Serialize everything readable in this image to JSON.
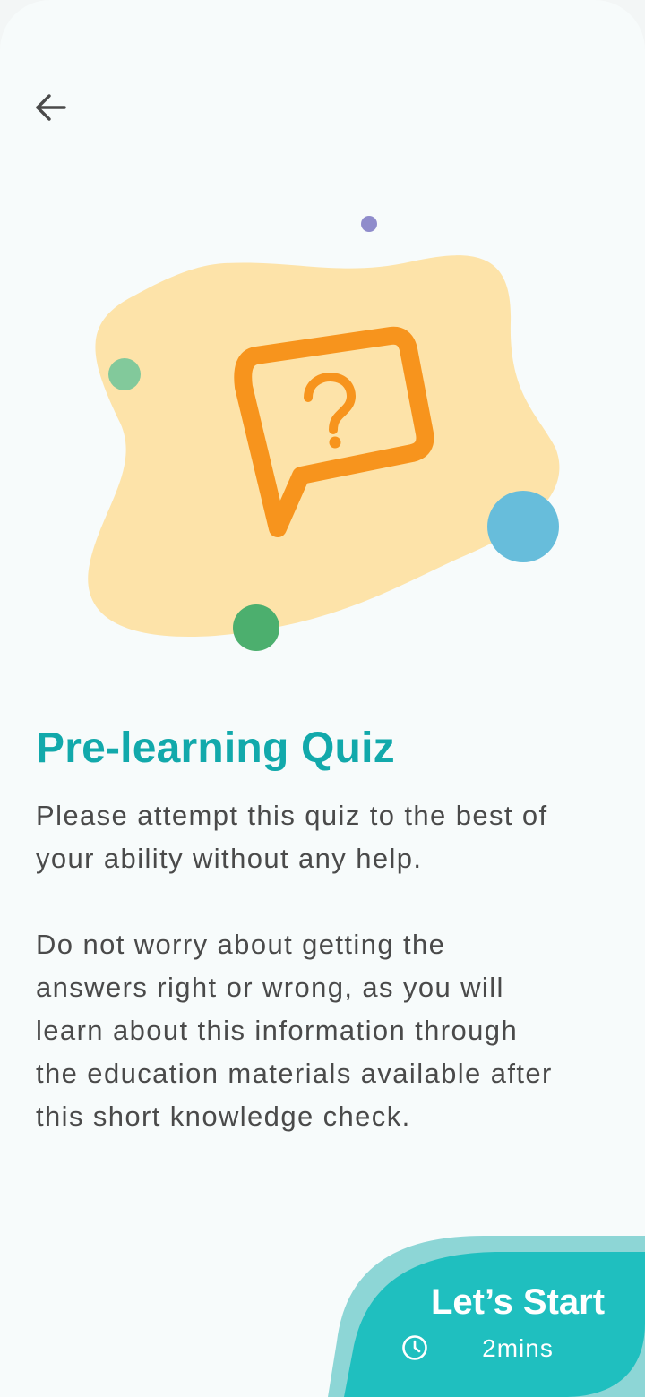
{
  "header": {
    "back_icon": "arrow-left-icon"
  },
  "illustration": {
    "icon": "question-speech-bubble-icon",
    "colors": {
      "blob": "#fde3a9",
      "bubble": "#f7941d",
      "dot_purple": "#8f8ccb",
      "dot_light_green": "#82c99b",
      "dot_blue": "#67bddb",
      "dot_green": "#4caf6e"
    }
  },
  "content": {
    "title": "Pre-learning Quiz",
    "paragraph_1_lines": [
      "Please attempt this quiz to the best of",
      "your ability without any help."
    ],
    "paragraph_2_lines": [
      "Do not worry about getting the",
      "answers right or wrong, as you will",
      "learn about this information through",
      "the education materials available after",
      "this short knowledge check."
    ]
  },
  "start_button": {
    "label": "Let’s Start",
    "duration": "2mins",
    "icon": "clock-icon"
  },
  "colors": {
    "accent": "#12a9ab",
    "button": "#1fbfbf",
    "button_shadow": "#8dd6d6",
    "text": "#4a4a4a",
    "background": "#f7fbfb"
  }
}
